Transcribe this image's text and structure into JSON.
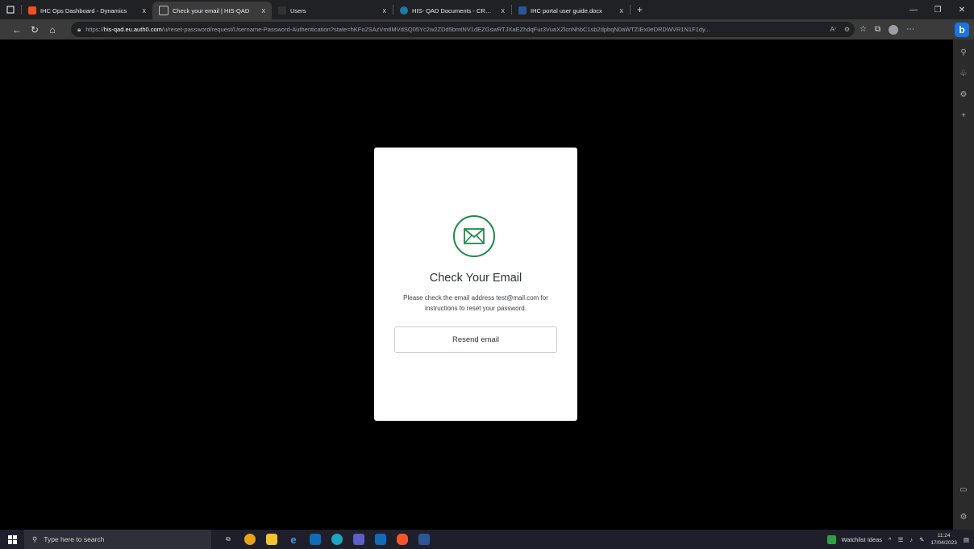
{
  "browser": {
    "tabs": [
      {
        "label": "IHC Ops Dashboard - Dynamics",
        "close": "x",
        "favicon_color": "#f25022",
        "active": false
      },
      {
        "label": "Check your email | HIS-QAD",
        "close": "x",
        "favicon_color": "#9aa0a6",
        "active": true
      },
      {
        "label": "Users",
        "close": "x",
        "favicon_color": "#1f1f1f",
        "active": false
      },
      {
        "label": "HIS- QAD Documents - CRM Hel",
        "close": "x",
        "favicon_color": "#1b7aa3",
        "active": false
      },
      {
        "label": "IHC portal user guide.docx",
        "close": "x",
        "favicon_color": "#2b579a",
        "active": false
      }
    ],
    "new_tab": "+",
    "address": {
      "prefix": "https://",
      "host": "his-qad.eu.auth0.com",
      "path": "/u/reset-password/request/Username-Password-Authentication?state=hKFo2SAzVmtlMVdSQ05Yc2w2ZDd5bmtNV1dEZGswRTJXaEZhdqFur3VuaXZlcnNhbC1sb2dpbqN0aWTZIEx0eDRDWVR1N1F1dy..."
    }
  },
  "card": {
    "title": "Check Your Email",
    "message": "Please check the email address test@mail.com for instructions to reset your password.",
    "resend_label": "Resend email",
    "accent_color": "#1d8a4a"
  },
  "taskbar": {
    "search_placeholder": "Type here to search",
    "widget_label": "Watchlist Ideas",
    "time": "11:24",
    "date": "17/04/2023"
  }
}
